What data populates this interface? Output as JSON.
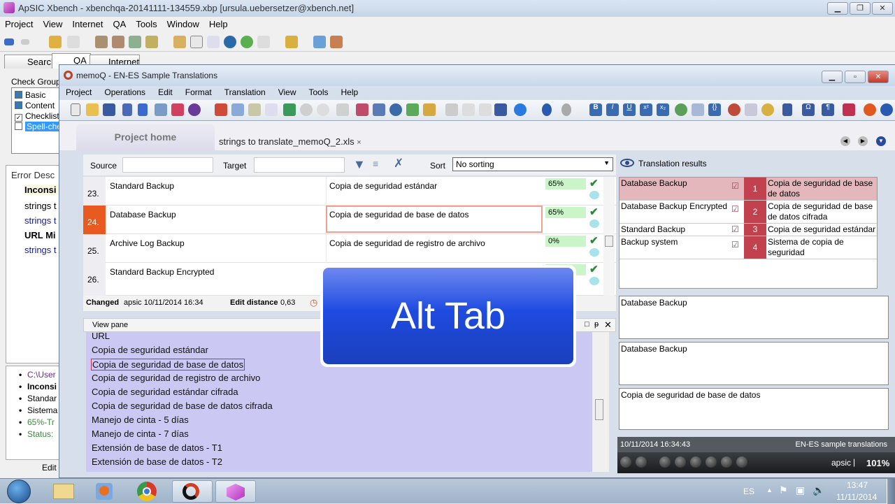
{
  "xbench": {
    "title": "ApSIC Xbench - xbenchqa-20141111-134559.xbp [ursula.uebersetzer@xbench.net]",
    "menu": [
      "Project",
      "View",
      "Internet",
      "QA",
      "Tools",
      "Window",
      "Help"
    ],
    "tabs": [
      "Search",
      "QA",
      "Internet"
    ],
    "check_groups_label": "Check Group",
    "check_groups": [
      {
        "label": "Basic",
        "state": "filled"
      },
      {
        "label": "Content",
        "state": "filled"
      },
      {
        "label": "Checklist",
        "state": "checked"
      },
      {
        "label": "Spell-che",
        "state": "unchecked",
        "selected": true
      }
    ],
    "error_header": "Error Desc",
    "errors": [
      {
        "text": "Inconsi",
        "style": "bold"
      },
      {
        "text": "strings t",
        "style": "normal"
      },
      {
        "text": "strings t",
        "style": "link"
      },
      {
        "text": "URL Mi",
        "style": "bold"
      },
      {
        "text": "strings t",
        "style": "link"
      }
    ],
    "details": [
      {
        "text": "C:\\User",
        "color": "#6a2a8a",
        "bold": false
      },
      {
        "text": "Inconsi",
        "color": "#000000",
        "bold": true
      },
      {
        "text": "Standar",
        "color": "#000000",
        "bold": false
      },
      {
        "text": "Sistema",
        "color": "#000000",
        "bold": false
      },
      {
        "text": "65%-Tr",
        "color": "#3a8a3a",
        "bold": false
      },
      {
        "text": "Status:",
        "color": "#3a8a3a",
        "bold": false
      }
    ],
    "edit_label": "Edit"
  },
  "memoq": {
    "title": "memoQ - EN-ES Sample Translations",
    "menu": [
      "Project",
      "Operations",
      "Edit",
      "Format",
      "Translation",
      "View",
      "Tools",
      "Help"
    ],
    "tab_home": "Project home",
    "tab_doc": "strings to translate_memoQ_2.xls",
    "tab_close": "×",
    "filter": {
      "source_label": "Source",
      "source_value": "",
      "target_label": "Target",
      "target_value": "",
      "sort_label": "Sort",
      "sort_value": "No sorting"
    },
    "rows": [
      {
        "num": "23.",
        "source": "Standard Backup",
        "target": "Copia de seguridad estándar",
        "match": "65%",
        "active": false
      },
      {
        "num": "24.",
        "source": "Database Backup",
        "target": "Copia de seguridad de base de datos",
        "match": "65%",
        "active": true
      },
      {
        "num": "25.",
        "source": "Archive Log Backup",
        "target": "Copia de seguridad de registro de archivo",
        "match": "0%",
        "active": false
      },
      {
        "num": "26.",
        "source": "Standard Backup Encrypted",
        "target": "",
        "match": "",
        "active": false
      }
    ],
    "status": {
      "changed_label": "Changed",
      "changed_value": "apsic 10/11/2014 16:34",
      "edit_distance_label": "Edit distance",
      "edit_distance_value": "0,63"
    },
    "view_pane": {
      "title": "View pane",
      "lines": [
        "URL",
        "Copia de seguridad estándar",
        "Copia de seguridad de base de datos",
        "Copia de seguridad de registro de archivo",
        "Copia de seguridad estándar cifrada",
        "Copia de seguridad de base de datos cifrada",
        "Manejo de cinta - 5 días",
        "Manejo de cinta - 7 días",
        "Extensión de base de datos - T1",
        "Extensión de base de datos - T2"
      ],
      "highlighted_index": 2
    },
    "translation_results": {
      "title": "Translation results",
      "items": [
        {
          "source": "Database Backup",
          "rank": "1",
          "target": "Copia de seguridad de base de datos",
          "selected": true
        },
        {
          "source": "Database Backup Encrypted",
          "rank": "2",
          "target": "Copia de seguridad de base de datos cifrada",
          "selected": false
        },
        {
          "source": "Standard Backup",
          "rank": "3",
          "target": "Copia de seguridad estándar",
          "selected": false
        },
        {
          "source": "Backup system",
          "rank": "4",
          "target": "Sistema de copia de seguridad",
          "selected": false
        }
      ],
      "compare_source": "Database Backup",
      "compare_match": "Database Backup",
      "compare_target": "Copia de seguridad de base de datos",
      "meta_date": "10/11/2014 16:34:43",
      "meta_tm": "EN-ES sample translations",
      "user": "apsic",
      "zoom": "101%"
    }
  },
  "overlay": {
    "text": "Alt Tab"
  },
  "taskbar": {
    "lang": "ES",
    "time": "13:47",
    "date": "11/11/2014",
    "apps": [
      "windows-explorer",
      "media-player",
      "chrome",
      "memoq",
      "xbench"
    ]
  }
}
